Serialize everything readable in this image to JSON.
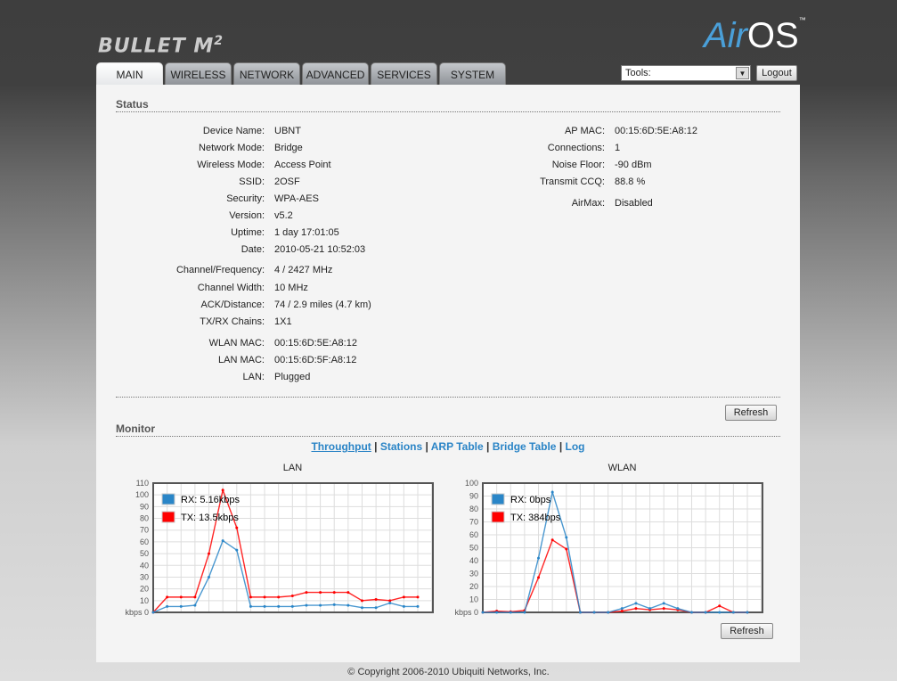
{
  "header": {
    "product_logo": "BULLET M2",
    "os_logo": "AirOS",
    "tools_label": "Tools:",
    "logout": "Logout"
  },
  "tabs": [
    {
      "label": "MAIN",
      "active": true
    },
    {
      "label": "WIRELESS"
    },
    {
      "label": "NETWORK"
    },
    {
      "label": "ADVANCED"
    },
    {
      "label": "SERVICES"
    },
    {
      "label": "SYSTEM"
    }
  ],
  "status": {
    "title": "Status",
    "left": [
      {
        "label": "Device Name:",
        "value": "UBNT"
      },
      {
        "label": "Network Mode:",
        "value": "Bridge"
      },
      {
        "label": "Wireless Mode:",
        "value": "Access Point"
      },
      {
        "label": "SSID:",
        "value": "2OSF"
      },
      {
        "label": "Security:",
        "value": "WPA-AES"
      },
      {
        "label": "Version:",
        "value": "v5.2"
      },
      {
        "label": "Uptime:",
        "value": "1 day 17:01:05"
      },
      {
        "label": "Date:",
        "value": "2010-05-21 10:52:03"
      },
      {
        "label": "Channel/Frequency:",
        "value": "4 / 2427 MHz"
      },
      {
        "label": "Channel Width:",
        "value": "10 MHz"
      },
      {
        "label": "ACK/Distance:",
        "value": "74 / 2.9 miles (4.7 km)"
      },
      {
        "label": "TX/RX Chains:",
        "value": "1X1"
      },
      {
        "label": "WLAN MAC:",
        "value": "00:15:6D:5E:A8:12"
      },
      {
        "label": "LAN MAC:",
        "value": "00:15:6D:5F:A8:12"
      },
      {
        "label": "LAN:",
        "value": "Plugged"
      }
    ],
    "right": [
      {
        "label": "AP MAC:",
        "value": "00:15:6D:5E:A8:12"
      },
      {
        "label": "Connections:",
        "value": "1"
      },
      {
        "label": "Noise Floor:",
        "value": "-90 dBm"
      },
      {
        "label": "Transmit CCQ:",
        "value": "88.8 %"
      },
      {
        "label": "AirMax:",
        "value": "Disabled"
      }
    ],
    "refresh": "Refresh"
  },
  "monitor": {
    "title": "Monitor",
    "links": [
      "Throughput",
      "Stations",
      "ARP Table",
      "Bridge Table",
      "Log"
    ],
    "active_link": "Throughput",
    "refresh": "Refresh"
  },
  "chart_data": [
    {
      "type": "line",
      "title": "LAN",
      "ylabel": "kbps",
      "ylim": [
        0,
        110
      ],
      "yticks": [
        0,
        10,
        20,
        30,
        40,
        50,
        60,
        70,
        80,
        90,
        100,
        110
      ],
      "grid": true,
      "legend": "top-left",
      "series": [
        {
          "name": "RX: 5.16kbps",
          "color": "#2a86c8",
          "values": [
            0,
            5,
            5,
            6,
            30,
            61,
            53,
            5,
            5,
            5,
            5,
            6,
            6,
            6.5,
            6,
            4,
            4,
            8,
            5,
            5
          ]
        },
        {
          "name": "TX: 13.5kbps",
          "color": "#ff0000",
          "values": [
            0,
            13,
            13,
            13,
            50,
            104,
            72,
            13,
            13,
            13,
            14,
            17,
            17,
            17,
            17,
            10,
            11,
            10,
            13,
            13
          ]
        }
      ]
    },
    {
      "type": "line",
      "title": "WLAN",
      "ylabel": "kbps",
      "ylim": [
        0,
        100
      ],
      "yticks": [
        0,
        10,
        20,
        30,
        40,
        50,
        60,
        70,
        80,
        90,
        100
      ],
      "grid": true,
      "legend": "top-left",
      "series": [
        {
          "name": "RX: 0bps",
          "color": "#2a86c8",
          "values": [
            0,
            0,
            0,
            0,
            42,
            93,
            58,
            0,
            0,
            0,
            3,
            7,
            3,
            7,
            3,
            0,
            0,
            0,
            0,
            0
          ]
        },
        {
          "name": "TX: 384bps",
          "color": "#ff0000",
          "values": [
            0,
            1,
            0.5,
            1.5,
            27,
            56,
            49,
            0,
            0,
            0,
            1,
            3,
            2,
            3,
            2,
            0,
            0,
            5,
            0,
            0
          ]
        }
      ]
    }
  ],
  "footer": "© Copyright 2006-2010 Ubiquiti Networks, Inc."
}
